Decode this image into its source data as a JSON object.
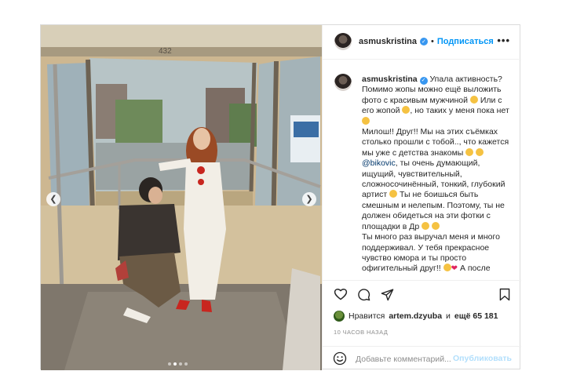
{
  "header": {
    "username": "asmuskristina",
    "verified_icon": "verified-badge-icon",
    "separator": "•",
    "follow_label": "Подписаться",
    "more_icon": "more-options-icon"
  },
  "photo": {
    "tram_number": "432",
    "carousel_dots": 4,
    "active_dot": 2
  },
  "caption": {
    "username": "asmuskristina",
    "lines": [
      "Упала активность? Помимо жопы можно ещё выложить фото с красивым мужчиной",
      "Или с его жопой",
      ", но таких у меня пока нет",
      "Милош!! Друг!! Мы на этих съёмках столько прошли с тобой.., что кажется мы уже с детства знакомы",
      "@bikovic",
      ", ты очень думающий, ищущий, чувствительный, сложносочинённый, тонкий, глубокий артист",
      "Ты не боишься быть смешным и нелепым. Поэтому, ты не должен обидеться на эти фотки с площадки в Др",
      "Ты много раз выручал меня и много поддерживал. У тебя прекрасное чувство юмора и ты просто офигительный друг!!",
      "А после"
    ]
  },
  "likes": {
    "prefix": "Нравится",
    "user": "artem.dzyuba",
    "middle": "и",
    "others": "ещё 65 181"
  },
  "timestamp": "10 ЧАСОВ НАЗАД",
  "comment": {
    "placeholder": "Добавьте комментарий...",
    "post_label": "Опубликовать"
  },
  "colors": {
    "accent": "#0095f6",
    "verified": "#3897f0",
    "post_disabled": "#b2dffc",
    "muted": "#8e8e8e"
  }
}
